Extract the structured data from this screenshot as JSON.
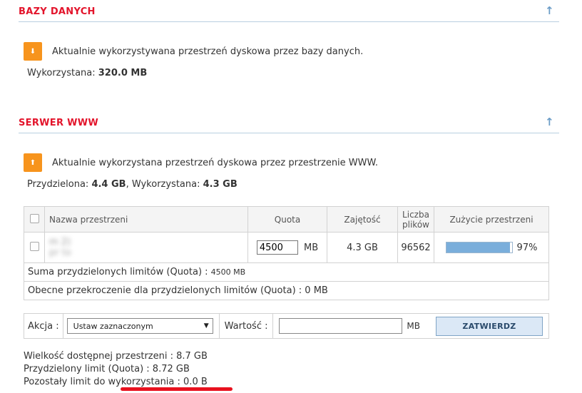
{
  "db_section": {
    "title": "BAZY DANYCH",
    "info": "Aktualnie wykorzystywana przestrzeń dyskowa przez bazy danych.",
    "used_label": "Wykorzystana:",
    "used_value": "320.0 MB"
  },
  "www_section": {
    "title": "SERWER WWW",
    "info": "Aktualnie wykorzystana przestrzeń dyskowa przez przestrzenie WWW.",
    "assigned_label": "Przydzielona:",
    "assigned_value": "4.4 GB",
    "used_label": ", Wykorzystana:",
    "used_value": "4.3 GB"
  },
  "table": {
    "headers": {
      "name": "Nazwa przestrzeni",
      "quota": "Quota",
      "used": "Zajętość",
      "files_line1": "Liczba",
      "files_line2": "plików",
      "usage": "Zużycie przestrzeni"
    },
    "row": {
      "name_line1": "m                              2)",
      "name_line2": "pr                              to",
      "quota_value": "4500",
      "quota_unit": "MB",
      "used": "4.3 GB",
      "files": "96562",
      "usage_percent": 97,
      "usage_label": "97%"
    },
    "sum_label": "Suma przydzielonych limitów (Quota) :",
    "sum_value": "4500 MB",
    "exceed_label": "Obecne przekroczenie dla przydzielonych limitów (Quota) :",
    "exceed_value": "0 MB"
  },
  "action": {
    "label": "Akcja :",
    "select_value": "Ustaw zaznaczonym",
    "value_label": "Wartość :",
    "value_input": "",
    "unit": "MB",
    "submit": "ZATWIERDZ"
  },
  "summary": {
    "line1": "Wielkość dostępnej przestrzeni : 8.7 GB",
    "line2": "Przydzielony limit (Quota) : 8.72 GB",
    "line3": "Pozostały limit do wykorzystania : 0.0 B"
  },
  "colors": {
    "title": "#e3142b",
    "accent": "#f7941d",
    "bar": "#7aaedb",
    "underline": "#e8121f"
  },
  "icons": {
    "scroll_up": "arrow-up-icon",
    "info": "info-icon"
  }
}
